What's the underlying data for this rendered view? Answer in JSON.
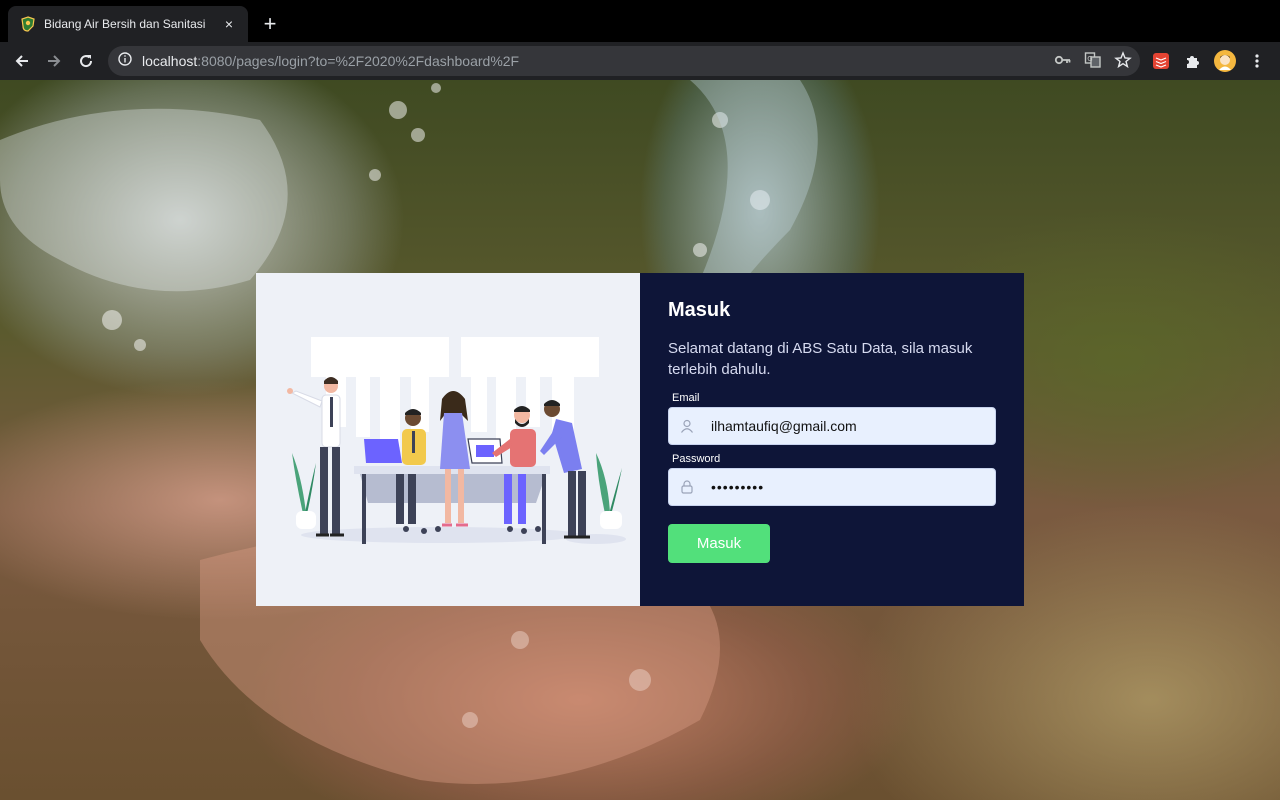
{
  "browser": {
    "tab_title": "Bidang Air Bersih dan Sanitasi",
    "tab_close": "×",
    "new_tab": "+",
    "url_host": "localhost",
    "url_rest": ":8080/pages/login?to=%2F2020%2Fdashboard%2F",
    "icons": [
      "back-icon",
      "forward-icon",
      "reload-icon",
      "info-icon",
      "key-icon",
      "translate-icon",
      "star-icon",
      "todoist-extension-icon",
      "puzzle-icon",
      "profile-avatar",
      "menu-dots-icon"
    ]
  },
  "login": {
    "heading": "Masuk",
    "welcome": "Selamat datang di ABS Satu Data, sila masuk terlebih dahulu.",
    "email_label": "Email",
    "email_value": "ilhamtaufiq@gmail.com",
    "password_label": "Password",
    "password_value": "abcdefghi",
    "submit_label": "Masuk"
  },
  "colors": {
    "panel_dark": "#0e1538",
    "panel_light": "#eef1f7",
    "button_green": "#52e07b",
    "input_bg": "#e8f0fe"
  }
}
